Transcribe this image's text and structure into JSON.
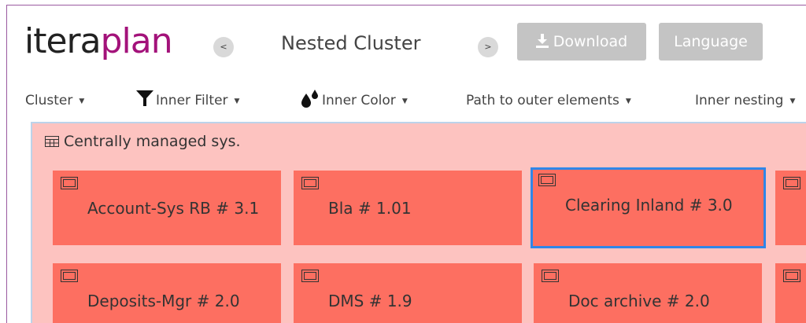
{
  "header": {
    "logo_part1": "itera",
    "logo_part2": "plan",
    "prev_symbol": "<",
    "next_symbol": ">",
    "title": "Nested Cluster",
    "download_label": "Download",
    "language_label": "Language"
  },
  "toolbar": {
    "items": [
      {
        "label": "Cluster"
      },
      {
        "label": "Inner Filter"
      },
      {
        "label": "Inner Color"
      },
      {
        "label": "Path to outer elements"
      },
      {
        "label": "Inner nesting"
      }
    ]
  },
  "cluster": {
    "title": "Centrally managed sys.",
    "tiles": [
      {
        "label": "Account-Sys RB # 3.1"
      },
      {
        "label": "Bla # 1.01"
      },
      {
        "label": "Clearing Inland # 3.0"
      },
      {
        "label": ""
      },
      {
        "label": "Deposits-Mgr # 2.0"
      },
      {
        "label": "DMS # 1.9"
      },
      {
        "label": "Doc archive # 2.0"
      },
      {
        "label": ""
      }
    ]
  },
  "colors": {
    "brand_dark": "#222222",
    "brand_accent": "#a3127a",
    "cluster_bg": "#fdc3c0",
    "tile_bg": "#fd6f61",
    "selected_border": "#2f86e8",
    "button_bg": "#c4c4c4"
  },
  "icons": {
    "download": "download-icon",
    "filter": "funnel-icon",
    "color": "paint-drops-icon",
    "cluster": "grid-icon",
    "tile": "component-icon"
  }
}
